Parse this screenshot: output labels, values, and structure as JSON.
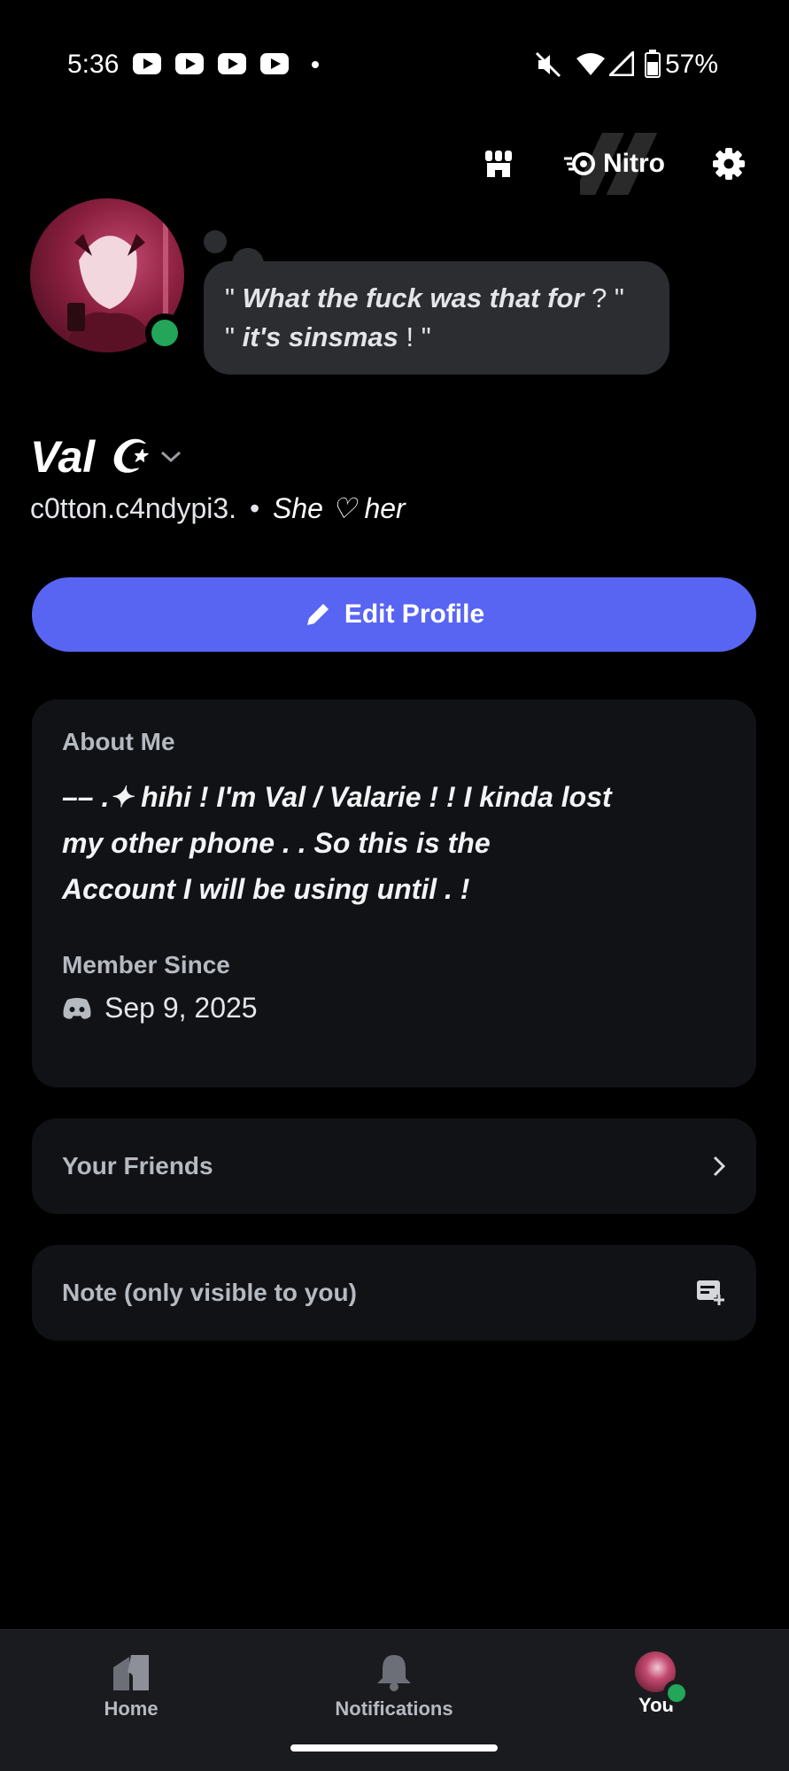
{
  "status_bar": {
    "time": "5:36",
    "notification_icons": [
      "youtube-icon",
      "youtube-icon",
      "youtube-icon",
      "youtube-icon"
    ],
    "battery": "57%"
  },
  "top_actions": {
    "shop_icon": "shop-icon",
    "nitro_label": "Nitro",
    "settings_icon": "gear-icon"
  },
  "profile": {
    "status_line1_q1": "\"",
    "status_line1_text": "What the fuck was that for",
    "status_line1_end": "? \"",
    "status_line2_q1": "\"",
    "status_line2_text": "it's sinsmas",
    "status_line2_end": "! \"",
    "display_name": "Val ☪",
    "username": "c0tton.c4ndypi3.",
    "separator": "•",
    "pronouns": "She ♡ her",
    "edit_button": "Edit Profile"
  },
  "about_card": {
    "title": "About Me",
    "bio_line1": "–– .✦ hihi ! I'm Val / Valarie ! ! I kinda lost",
    "bio_line2": "my other phone . . So this is the",
    "bio_line3": "Account I will be using until . !",
    "member_since_label": "Member Since",
    "member_since_date": "Sep 9, 2025"
  },
  "friends_card": {
    "label": "Your Friends"
  },
  "note_card": {
    "label": "Note (only visible to you)"
  },
  "bottom_nav": {
    "home": "Home",
    "notifications": "Notifications",
    "you": "You"
  },
  "colors": {
    "accent": "#5865f2",
    "online": "#23a55a",
    "card": "#111216"
  }
}
